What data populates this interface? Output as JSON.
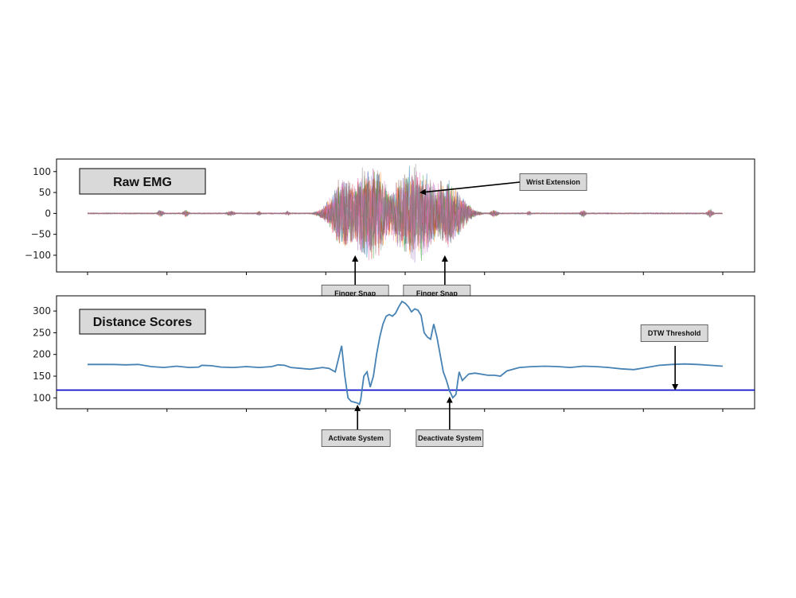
{
  "chart_data": [
    {
      "type": "line",
      "label": "Raw EMG",
      "ylim": [
        -140,
        130
      ],
      "yticks": [
        -100,
        -50,
        0,
        50,
        100
      ],
      "ytick_labels": [
        "−100",
        "−50",
        "0",
        "50",
        "100"
      ],
      "x_range": [
        0,
        1000
      ],
      "series_colors": [
        "#1f77b4",
        "#ff7f0e",
        "#2ca02c",
        "#d62728",
        "#9467bd",
        "#8c564b",
        "#e377c2",
        "#7f7f7f"
      ],
      "bursts": [
        {
          "center": 115,
          "width": 4,
          "amplitude": 10
        },
        {
          "center": 155,
          "width": 4,
          "amplitude": 10
        },
        {
          "center": 225,
          "width": 6,
          "amplitude": 7
        },
        {
          "center": 270,
          "width": 3,
          "amplitude": 6
        },
        {
          "center": 315,
          "width": 3,
          "amplitude": 6
        },
        {
          "center": 390,
          "width": 3,
          "amplitude": 6
        },
        {
          "center": 405,
          "width": 22,
          "amplitude": 95
        },
        {
          "center": 445,
          "width": 30,
          "amplitude": 125
        },
        {
          "center": 515,
          "width": 35,
          "amplitude": 130
        },
        {
          "center": 565,
          "width": 25,
          "amplitude": 90
        },
        {
          "center": 590,
          "width": 12,
          "amplitude": 15
        },
        {
          "center": 640,
          "width": 5,
          "amplitude": 10
        },
        {
          "center": 695,
          "width": 3,
          "amplitude": 6
        },
        {
          "center": 780,
          "width": 4,
          "amplitude": 10
        },
        {
          "center": 980,
          "width": 4,
          "amplitude": 12
        }
      ],
      "annotations": [
        {
          "text": "Wrist Extension",
          "target_x": 520,
          "target_y": 50
        },
        {
          "text": "Finger Snap",
          "target_x": 420,
          "target_y": -100
        },
        {
          "text": "Finger Snap",
          "target_x": 565,
          "target_y": -100
        }
      ]
    },
    {
      "type": "line",
      "label": "Distance Scores",
      "ylim": [
        75,
        335
      ],
      "yticks": [
        100,
        150,
        200,
        250,
        300
      ],
      "ytick_labels": [
        "100",
        "150",
        "200",
        "250",
        "300"
      ],
      "x_range": [
        0,
        1000
      ],
      "line_color": "#4682b4",
      "threshold_color": "#0000cd",
      "threshold": 118,
      "x": [
        0,
        20,
        40,
        60,
        80,
        100,
        120,
        140,
        160,
        175,
        180,
        195,
        210,
        230,
        250,
        270,
        290,
        300,
        310,
        320,
        335,
        350,
        370,
        380,
        390,
        395,
        400,
        405,
        410,
        415,
        420,
        425,
        428,
        430,
        435,
        440,
        445,
        450,
        455,
        460,
        465,
        470,
        475,
        480,
        485,
        490,
        495,
        500,
        505,
        510,
        515,
        520,
        525,
        530,
        535,
        540,
        545,
        550,
        555,
        560,
        565,
        570,
        572,
        575,
        580,
        585,
        590,
        600,
        610,
        630,
        640,
        650,
        660,
        680,
        700,
        720,
        740,
        760,
        780,
        800,
        820,
        840,
        860,
        880,
        900,
        920,
        940,
        960,
        980,
        1000
      ],
      "y": [
        177,
        177,
        177,
        176,
        177,
        172,
        170,
        173,
        170,
        171,
        175,
        174,
        171,
        170,
        172,
        170,
        172,
        176,
        175,
        170,
        168,
        166,
        170,
        168,
        160,
        190,
        220,
        150,
        100,
        92,
        90,
        88,
        85,
        95,
        150,
        160,
        125,
        150,
        200,
        240,
        270,
        288,
        292,
        288,
        295,
        310,
        322,
        318,
        310,
        298,
        305,
        302,
        290,
        250,
        240,
        235,
        270,
        240,
        200,
        160,
        140,
        115,
        110,
        100,
        108,
        160,
        140,
        155,
        157,
        152,
        152,
        150,
        162,
        170,
        172,
        173,
        172,
        170,
        173,
        172,
        170,
        167,
        165,
        170,
        175,
        177,
        178,
        177,
        175,
        173,
        168
      ],
      "annotations": [
        {
          "text": "Activate System",
          "target_x": 425,
          "target_y": 88
        },
        {
          "text": "Deactivate System",
          "target_x": 570,
          "target_y": 103
        },
        {
          "text": "DTW Threshold",
          "target_x": 925,
          "target_y": 119
        }
      ]
    }
  ]
}
